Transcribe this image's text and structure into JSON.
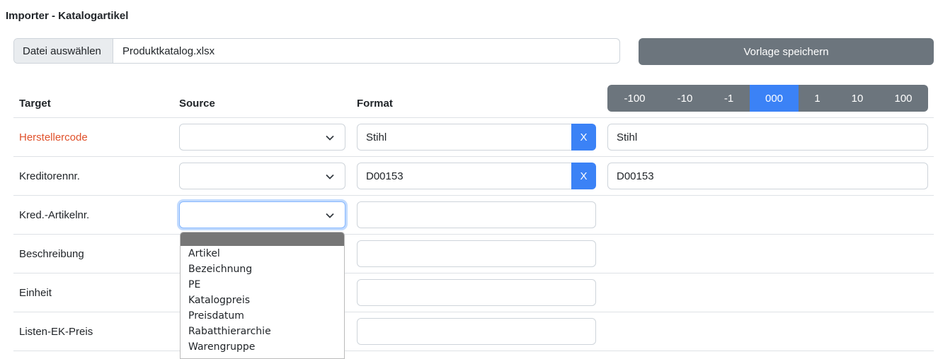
{
  "page": {
    "title": "Importer - Katalogartikel"
  },
  "file": {
    "button_label": "Datei auswählen",
    "filename": "Produktkatalog.xlsx"
  },
  "toolbar": {
    "save_template_label": "Vorlage speichern"
  },
  "stepper": {
    "options": [
      "-100",
      "-10",
      "-1",
      "000",
      "1",
      "10",
      "100"
    ],
    "selected": "000"
  },
  "table": {
    "headers": {
      "target": "Target",
      "source": "Source",
      "format": "Format"
    },
    "rows": [
      {
        "target": "Herstellercode",
        "required": true,
        "format": "Stihl",
        "clear_label": "X",
        "preview": "Stihl"
      },
      {
        "target": "Kreditorennr.",
        "format": "D00153",
        "clear_label": "X",
        "preview": "D00153"
      },
      {
        "target": "Kred.-Artikelnr.",
        "format": ""
      },
      {
        "target": "Beschreibung",
        "format": ""
      },
      {
        "target": "Einheit",
        "format": ""
      },
      {
        "target": "Listen-EK-Preis",
        "format": ""
      }
    ]
  },
  "source_dropdown": {
    "open_for_row": "Kred.-Artikelnr.",
    "options": [
      "Artikel",
      "Bezeichnung",
      "PE",
      "Katalogpreis",
      "Preisdatum",
      "Rabatthierarchie",
      "Warengruppe"
    ]
  },
  "colors": {
    "primary": "#3b82f6",
    "secondary": "#6c757d",
    "required": "#e0512b",
    "border": "#ced4da"
  }
}
